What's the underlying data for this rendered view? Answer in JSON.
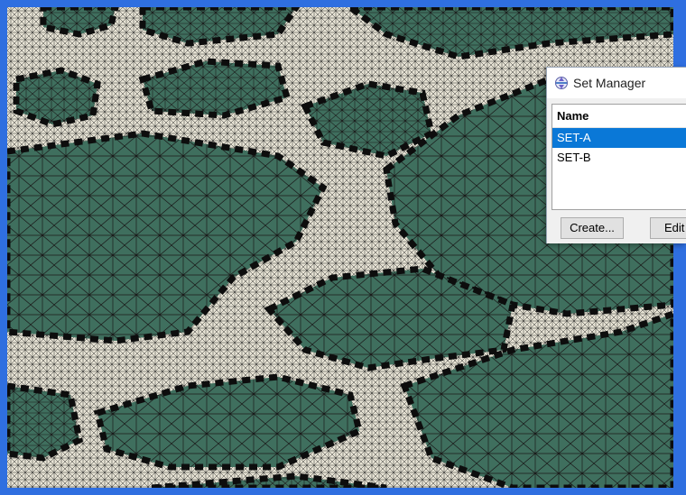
{
  "window": {
    "title": "Set Manager"
  },
  "set_list": {
    "header": "Name",
    "items": [
      {
        "label": "SET-A",
        "selected": true
      },
      {
        "label": "SET-B",
        "selected": false
      }
    ]
  },
  "buttons": {
    "create_label": "Create...",
    "edit_label": "Edit"
  },
  "icons": {
    "title_icon": "set-manager-icon"
  },
  "colors": {
    "frame": "#2f6fe0",
    "mesh_fill": "#3f6f5e",
    "mesh_light": "#e6e2d4",
    "mesh_edges": "#111111",
    "selection": "#0a78d7"
  }
}
